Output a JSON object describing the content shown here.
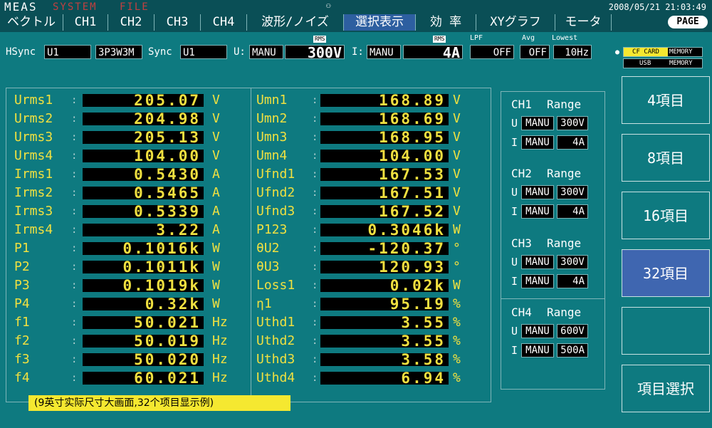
{
  "header": {
    "modes": [
      "MEAS",
      "SYSTEM",
      "FILE"
    ],
    "clock": "2008/05/21 21:03:49",
    "usb_icon": "usb-icon"
  },
  "tabs": [
    "ベクトル",
    "CH1",
    "CH2",
    "CH3",
    "CH4",
    "波形/ノイズ",
    "選択表示",
    "効 率",
    "XYグラフ",
    "モータ"
  ],
  "page_label": "PAGE",
  "settings": {
    "hsync_label": "HSync",
    "hsync_value": "U1",
    "wiring_value": "3P3W3M",
    "sync_label": "Sync",
    "sync_value": "U1",
    "u_label": "U:",
    "u_mode": "MANU",
    "u_range": "300V",
    "i_label": "I:",
    "i_mode": "MANU",
    "i_range": "4A",
    "rms_tag": "RMS",
    "lpf_label": "LPF",
    "lpf_value": "OFF",
    "avg_label": "Avg",
    "avg_value": "OFF",
    "lowest_label": "Lowest",
    "lowest_value": "10Hz"
  },
  "storage": {
    "cf": "CF CARD",
    "memory1": "MEMORY",
    "usb": "USB",
    "memory2": "MEMORY"
  },
  "measurements_left": [
    {
      "name": "Urms1",
      "value": "205.07",
      "unit": "V"
    },
    {
      "name": "Urms2",
      "value": "204.98",
      "unit": "V"
    },
    {
      "name": "Urms3",
      "value": "205.13",
      "unit": "V"
    },
    {
      "name": "Urms4",
      "value": "104.00",
      "unit": "V"
    },
    {
      "name": "Irms1",
      "value": "0.5430",
      "unit": "A"
    },
    {
      "name": "Irms2",
      "value": "0.5465",
      "unit": "A"
    },
    {
      "name": "Irms3",
      "value": "0.5339",
      "unit": "A"
    },
    {
      "name": "Irms4",
      "value": "3.22",
      "unit": "A"
    },
    {
      "name": "P1",
      "value": "0.1016k",
      "unit": "W"
    },
    {
      "name": "P2",
      "value": "0.1011k",
      "unit": "W"
    },
    {
      "name": "P3",
      "value": "0.1019k",
      "unit": "W"
    },
    {
      "name": "P4",
      "value": "0.32k",
      "unit": "W"
    },
    {
      "name": "f1",
      "value": "50.021",
      "unit": "Hz"
    },
    {
      "name": "f2",
      "value": "50.019",
      "unit": "Hz"
    },
    {
      "name": "f3",
      "value": "50.020",
      "unit": "Hz"
    },
    {
      "name": "f4",
      "value": "60.021",
      "unit": "Hz"
    }
  ],
  "measurements_right": [
    {
      "name": "Umn1",
      "value": "168.89",
      "unit": "V"
    },
    {
      "name": "Umn2",
      "value": "168.69",
      "unit": "V"
    },
    {
      "name": "Umn3",
      "value": "168.95",
      "unit": "V"
    },
    {
      "name": "Umn4",
      "value": "104.00",
      "unit": "V"
    },
    {
      "name": "Ufnd1",
      "value": "167.53",
      "unit": "V"
    },
    {
      "name": "Ufnd2",
      "value": "167.51",
      "unit": "V"
    },
    {
      "name": "Ufnd3",
      "value": "167.52",
      "unit": "V"
    },
    {
      "name": "P123",
      "value": "0.3046k",
      "unit": "W"
    },
    {
      "name": "θU2",
      "value": "-120.37",
      "unit": "°"
    },
    {
      "name": "θU3",
      "value": "120.93",
      "unit": "°"
    },
    {
      "name": "Loss1",
      "value": "0.02k",
      "unit": "W"
    },
    {
      "name": "η1",
      "value": "95.19",
      "unit": "%"
    },
    {
      "name": "Uthd1",
      "value": "3.55",
      "unit": "%"
    },
    {
      "name": "Uthd2",
      "value": "3.55",
      "unit": "%"
    },
    {
      "name": "Uthd3",
      "value": "3.58",
      "unit": "%"
    },
    {
      "name": "Uthd4",
      "value": "6.94",
      "unit": "%"
    }
  ],
  "ranges": [
    {
      "ch": "CH1",
      "range_label": "Range",
      "u_mode": "MANU",
      "u_range": "300V",
      "i_mode": "MANU",
      "i_range": "4A"
    },
    {
      "ch": "CH2",
      "range_label": "Range",
      "u_mode": "MANU",
      "u_range": "300V",
      "i_mode": "MANU",
      "i_range": "4A"
    },
    {
      "ch": "CH3",
      "range_label": "Range",
      "u_mode": "MANU",
      "u_range": "300V",
      "i_mode": "MANU",
      "i_range": "4A"
    },
    {
      "ch": "CH4",
      "range_label": "Range",
      "u_mode": "MANU",
      "u_range": "600V",
      "i_mode": "MANU",
      "i_range": "500A"
    }
  ],
  "side_buttons": [
    "4項目",
    "8項目",
    "16項目",
    "32項目",
    "",
    "項目選択"
  ],
  "caption": "(9英寸实际尺寸大画面,32个项目显示例)",
  "colors": {
    "background": "#0e7a80",
    "value_text": "#f0e040",
    "active_tab": "#2d5fa0",
    "active_button": "#3f66b0",
    "caption_bg": "#f5e830"
  }
}
